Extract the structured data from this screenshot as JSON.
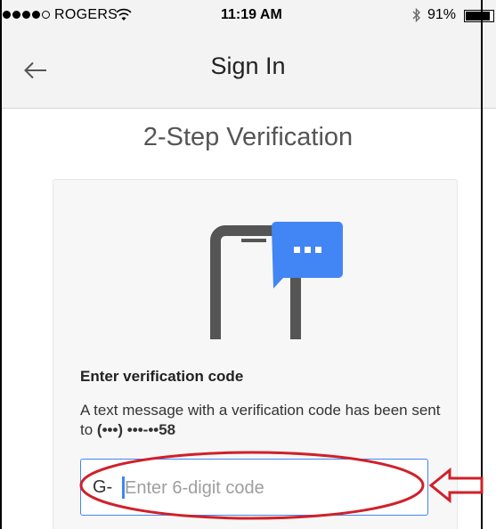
{
  "status_bar": {
    "carrier": "ROGERS",
    "time": "11:19 AM",
    "battery_percent": "91%",
    "battery_level": 0.91,
    "signal_bars": 4,
    "signal_total": 5
  },
  "nav": {
    "title": "Sign In",
    "back_icon": "arrow-left-icon"
  },
  "page": {
    "heading": "2-Step Verification"
  },
  "card": {
    "illustration_icons": [
      "phone-icon",
      "chat-bubble-icon"
    ],
    "heading": "Enter verification code",
    "message_prefix": "A text message with a verification code has been sent to ",
    "phone_masked": "(•••) •••-••58",
    "code_field": {
      "prefix": "G-",
      "value": "",
      "placeholder": "Enter 6-digit code"
    }
  },
  "colors": {
    "accent": "#4285f4",
    "annotation": "#d0202a",
    "chrome_bg": "#f3f3f3",
    "card_bg": "#f7f7f7"
  }
}
